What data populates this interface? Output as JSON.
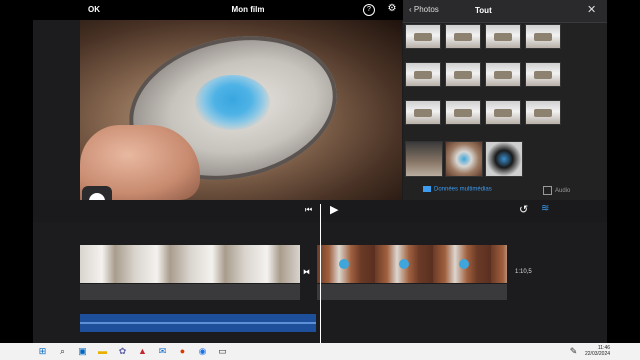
{
  "topbar": {
    "ok_label": "OK",
    "title": "Mon film"
  },
  "browser": {
    "back_label": "Photos",
    "title": "Tout",
    "tabs": {
      "media": "Données multimédias",
      "audio": "Audio"
    }
  },
  "timeline": {
    "clip_duration": "1:10,5"
  },
  "taskbar": {
    "time": "11:46",
    "date": "22/03/2024"
  },
  "colors": {
    "accent": "#3d9bf0",
    "app_bg": "#1c1c1e",
    "audio_track": "#1d4f9a"
  }
}
